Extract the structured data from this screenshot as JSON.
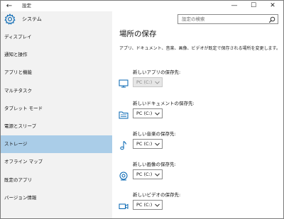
{
  "window": {
    "title": "設定",
    "back_glyph": "←",
    "minimize_glyph": "—",
    "maximize_glyph": "☐",
    "close_glyph": "✕"
  },
  "sidebar": {
    "app_name": "システム",
    "items": [
      {
        "label": "ディスプレイ",
        "active": false
      },
      {
        "label": "通知と操作",
        "active": false
      },
      {
        "label": "アプリと機能",
        "active": false
      },
      {
        "label": "マルチタスク",
        "active": false
      },
      {
        "label": "タブレット モード",
        "active": false
      },
      {
        "label": "電源とスリープ",
        "active": false
      },
      {
        "label": "ストレージ",
        "active": true
      },
      {
        "label": "オフライン マップ",
        "active": false
      },
      {
        "label": "既定のアプリ",
        "active": false
      },
      {
        "label": "バージョン情報",
        "active": false
      }
    ]
  },
  "search": {
    "placeholder": "設定の検索",
    "icon": "search-icon"
  },
  "main": {
    "title": "場所の保存",
    "description": "アプリ、ドキュメント、音楽、画像、ビデオが既定で保存される場所を変更します。",
    "rows": [
      {
        "label": "新しいアプリの保存先:",
        "value": "PC (C:)",
        "icon": "monitor-icon",
        "disabled": true
      },
      {
        "label": "新しいドキュメントの保存先:",
        "value": "PC (C:)",
        "icon": "document-folder-icon",
        "disabled": false
      },
      {
        "label": "新しい音楽の保存先:",
        "value": "PC (C:)",
        "icon": "music-note-icon",
        "disabled": false
      },
      {
        "label": "新しい画像の保存先:",
        "value": "PC (C:)",
        "icon": "camera-icon",
        "disabled": false
      },
      {
        "label": "新しいビデオの保存先:",
        "value": "PC (C:)",
        "icon": "video-camera-icon",
        "disabled": false
      }
    ]
  },
  "colors": {
    "accent": "#0063b1",
    "sidebar_bg": "#f2f2f2",
    "active_item_bg": "#aacde8"
  }
}
